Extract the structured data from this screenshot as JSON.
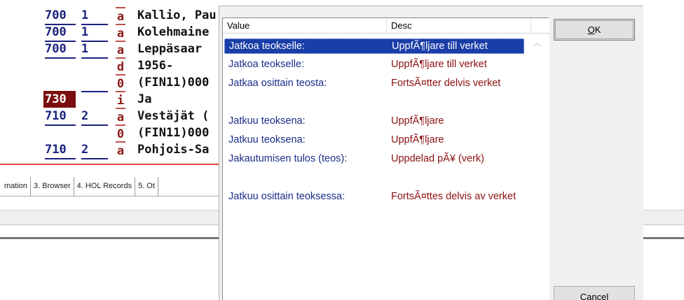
{
  "marc": {
    "rows": [
      {
        "tag": "700",
        "ind": "1",
        "sub": "a",
        "value": "Kallio, Pau"
      },
      {
        "tag": "700",
        "ind": "1",
        "sub": "a",
        "value": "Kolehmaine"
      },
      {
        "tag": "700",
        "ind": "1",
        "sub": "a",
        "value": "Leppäsaar"
      },
      {
        "tag": "",
        "ind": "",
        "sub": "d",
        "value": "1956-"
      },
      {
        "tag": "",
        "ind": "",
        "sub": "0",
        "value": "(FIN11)000"
      },
      {
        "tag": "730",
        "ind": "",
        "sub": "i",
        "value": "Ja"
      },
      {
        "tag": "710",
        "ind": "2",
        "sub": "a",
        "value": "Vestäjät ("
      },
      {
        "tag": "",
        "ind": "",
        "sub": "0",
        "value": "(FIN11)000"
      },
      {
        "tag": "710",
        "ind": "2",
        "sub": "a",
        "value": "Pohjois-Sa"
      }
    ]
  },
  "tabs": [
    "mation",
    "3. Browser",
    "4. HOL Records",
    "5. Ot"
  ],
  "dialog": {
    "columns": [
      "Value",
      "Desc"
    ],
    "rows": [
      {
        "value": "Jatkoa teokselle:",
        "desc": "UppfÃ¶ljare till verket",
        "selected": true
      },
      {
        "value": "Jatkoa teokselle:",
        "desc": "UppfÃ¶ljare till verket",
        "selected": false
      },
      {
        "value": "Jatkaa osittain teosta:",
        "desc": "FortsÃ¤tter delvis verket",
        "selected": false
      },
      {
        "value": "Jatkuu teoksena:",
        "desc": "UppfÃ¶ljare",
        "selected": false
      },
      {
        "value": "Jatkuu teoksena:",
        "desc": "UppfÃ¶ljare",
        "selected": false
      },
      {
        "value": "Jakautumisen tulos (teos):",
        "desc": "Uppdelad pÃ¥ (verk)",
        "selected": false
      },
      {
        "value": "Jatkuu osittain teoksessa:",
        "desc": "FortsÃ¤ttes delvis av verket",
        "selected": false
      }
    ],
    "ok_mnemonic": "O",
    "ok_rest": "K",
    "cancel_label": "Cancel"
  }
}
